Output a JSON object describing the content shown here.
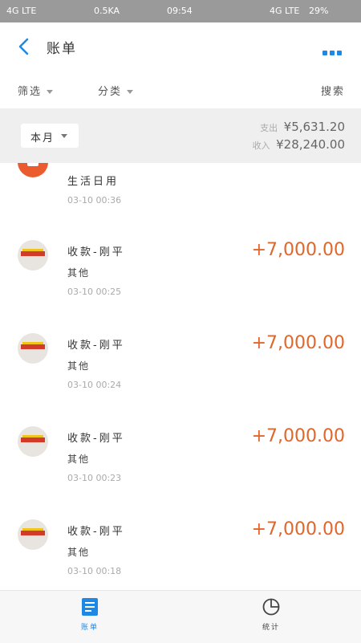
{
  "status": {
    "left": "4G LTE",
    "speed": "0.5KA",
    "time": "09:54",
    "right": "4G LTE",
    "battery": "29%"
  },
  "header": {
    "title": "账单"
  },
  "filters": {
    "filter_label": "筛选",
    "category_label": "分类",
    "search_label": "搜索"
  },
  "summary": {
    "month_label": "本月",
    "expense_label": "支出",
    "expense_value": "¥5,631.20",
    "income_label": "收入",
    "income_value": "¥28,240.00"
  },
  "transactions": [
    {
      "name": "生活日用",
      "category": "",
      "time": "03-10  00:36",
      "amount": ""
    },
    {
      "name": "收款-刚平",
      "category": "其他",
      "time": "03-10  00:25",
      "amount": "+7,000.00"
    },
    {
      "name": "收款-刚平",
      "category": "其他",
      "time": "03-10  00:24",
      "amount": "+7,000.00"
    },
    {
      "name": "收款-刚平",
      "category": "其他",
      "time": "03-10  00:23",
      "amount": "+7,000.00"
    },
    {
      "name": "收款-刚平",
      "category": "其他",
      "time": "03-10  00:18",
      "amount": "+7,000.00"
    }
  ],
  "nav": {
    "bills_label": "账单",
    "stats_label": "统计"
  },
  "colors": {
    "accent": "#1e88e5",
    "income": "#e0662b",
    "band": "#efefef"
  }
}
